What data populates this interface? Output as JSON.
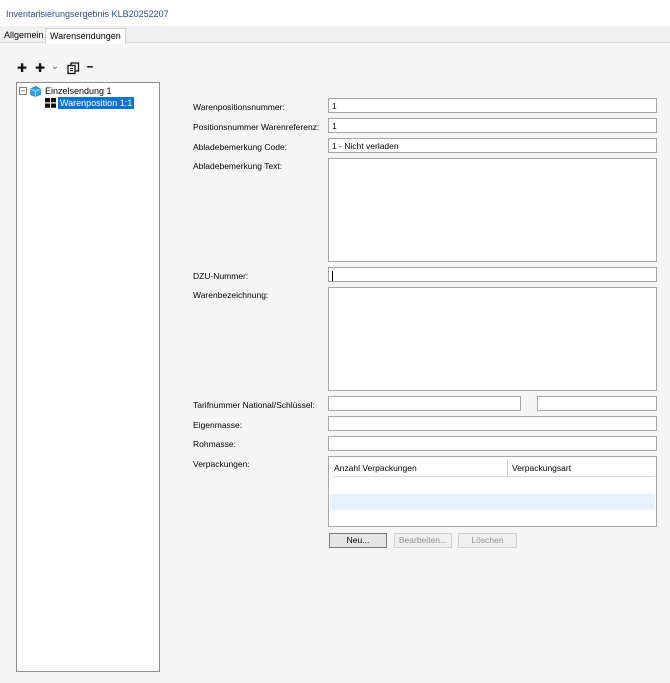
{
  "window": {
    "title": "Inventarisierungsergebnis  KLB20252207"
  },
  "tabs": [
    {
      "label": "Allgemein",
      "active": false
    },
    {
      "label": "Warensendungen",
      "active": true
    }
  ],
  "toolbar": {
    "add_icon": "plus-icon",
    "add_sub_icon": "plus-icon",
    "dropdown_icon": "chevron-down-icon",
    "copy_icon": "copy-icon",
    "remove_icon": "minus-icon",
    "add_glyph": "✚",
    "dropdown_glyph": "⌄",
    "remove_glyph": "━"
  },
  "tree": {
    "root": {
      "label": "Einzelsendung 1",
      "expander": "⊟",
      "icon": "cube-icon",
      "icon_color": "#3aa0e6"
    },
    "child": {
      "label": "Warenposition 1:1",
      "icon": "grid-icon",
      "selected": true,
      "selected_color": "#0b72d9"
    }
  },
  "form": {
    "warenpositionsnummer": {
      "label": "Warenpositionsnummer:",
      "value": "1"
    },
    "positionsnummer_referenz": {
      "label": "Positionsnummer Warenreferenz:",
      "value": "1"
    },
    "abladebemerkung_code": {
      "label": "Abladebemerkung Code:",
      "value": "1 - Nicht verladen"
    },
    "abladebemerkung_text": {
      "label": "Abladebemerkung Text:",
      "value": ""
    },
    "dzu_nummer": {
      "label": "DZU-Nummer:",
      "value": ""
    },
    "warenbezeichnung": {
      "label": "Warenbezeichnung:",
      "value": ""
    },
    "tarifnummer": {
      "label": "Tarifnummer National/Schlüssel:",
      "value_national": "",
      "value_schluessel": ""
    },
    "eigenmasse": {
      "label": "Eigenmasse:",
      "value": ""
    },
    "rohmasse": {
      "label": "Rohmasse:",
      "value": ""
    },
    "verpackungen": {
      "label": "Verpackungen:"
    }
  },
  "verpackungen_grid": {
    "columns": [
      "Anzahl Verpackungen",
      "Verpackungsart"
    ],
    "rows": [],
    "alt_row_color": "#e8f1fb"
  },
  "buttons": {
    "neu": {
      "label": "Neu...",
      "enabled": true
    },
    "bearbeiten": {
      "label": "Bearbeiten...",
      "enabled": false
    },
    "loeschen": {
      "label": "Löschen",
      "enabled": false
    }
  }
}
